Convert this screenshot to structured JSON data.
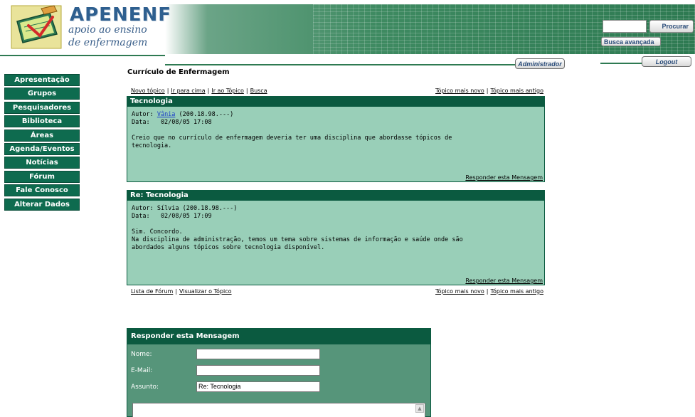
{
  "brand": {
    "name": "APENENF",
    "subtitle_line1": "apoio ao ensino",
    "subtitle_line2": "de enfermagem"
  },
  "search": {
    "button_label": "Procurar",
    "advanced_label": "Busca avançada"
  },
  "topbar": {
    "admin_label": "Administrador",
    "logout_label": "Logout"
  },
  "nav": {
    "items": [
      {
        "label": "Apresentação"
      },
      {
        "label": "Grupos"
      },
      {
        "label": "Pesquisadores"
      },
      {
        "label": "Biblioteca"
      },
      {
        "label": "Áreas"
      },
      {
        "label": "Agenda/Eventos"
      },
      {
        "label": "Notícias"
      },
      {
        "label": "Fórum"
      },
      {
        "label": "Fale Conosco"
      },
      {
        "label": "Alterar Dados"
      }
    ]
  },
  "page": {
    "title": "Currículo de Enfermagem"
  },
  "toplinks": {
    "new_topic": "Novo tópico",
    "go_up": "Ir para cima",
    "go_topic": "Ir ao Tópico",
    "search": "Busca",
    "newer": "Tópico mais novo",
    "older": "Tópico mais antigo"
  },
  "posts": [
    {
      "title": "Tecnologia",
      "author_prefix": "Autor: ",
      "author": "Vânia",
      "author_ip": " (200.18.98.---)",
      "date": "Data:   02/08/05 17:08",
      "body": "Creio que no currículo de enfermagem deveria ter uma disciplina que abordasse tópicos de\ntecnologia.",
      "reply_label": "Responder esta Mensagem"
    },
    {
      "title": "Re: Tecnologia",
      "author_line": "Autor: Sílvia (200.18.98.---)",
      "date": "Data:   02/08/05 17:09",
      "body": "Sim. Concordo.\nNa disciplina de administração, temos um tema sobre sistemas de informação e saúde onde são\nabordados alguns tópicos sobre tecnologia disponível.",
      "reply_label": "Responder esta Mensagem"
    }
  ],
  "bottomlinks": {
    "forum_list": "Lista de Fórum",
    "view_topic": "Visualizar o Tópico",
    "newer": "Tópico mais novo",
    "older": "Tópico mais antigo"
  },
  "reply_form": {
    "title": "Responder esta Mensagem",
    "name_label": "Nome:",
    "email_label": "E-Mail:",
    "subject_label": "Assunto:",
    "subject_value": "Re: Tecnologia"
  },
  "colors": {
    "primary_green": "#0b5a40",
    "post_bg": "#99cfb8",
    "form_bg": "#56957a",
    "nav_bg": "#0e6b4f"
  }
}
